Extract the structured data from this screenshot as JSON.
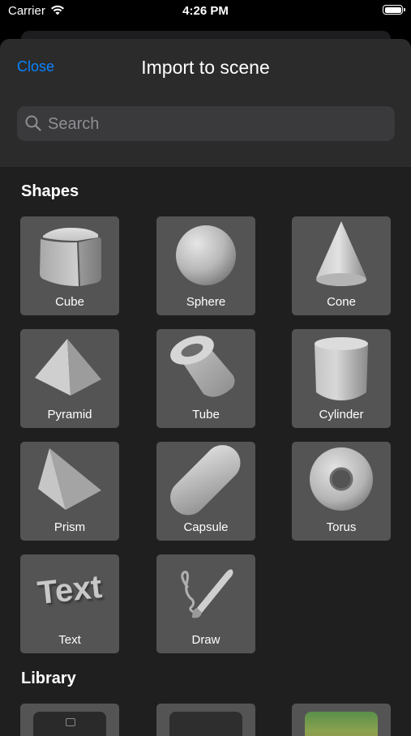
{
  "status_bar": {
    "carrier": "Carrier",
    "time": "4:26 PM"
  },
  "header": {
    "close_label": "Close",
    "title": "Import to scene",
    "search_placeholder": "Search"
  },
  "sections": {
    "shapes_title": "Shapes",
    "library_title": "Library"
  },
  "shapes": [
    {
      "label": "Cube",
      "icon": "cube-icon"
    },
    {
      "label": "Sphere",
      "icon": "sphere-icon"
    },
    {
      "label": "Cone",
      "icon": "cone-icon"
    },
    {
      "label": "Pyramid",
      "icon": "pyramid-icon"
    },
    {
      "label": "Tube",
      "icon": "tube-icon"
    },
    {
      "label": "Cylinder",
      "icon": "cylinder-icon"
    },
    {
      "label": "Prism",
      "icon": "prism-icon"
    },
    {
      "label": "Capsule",
      "icon": "capsule-icon"
    },
    {
      "label": "Torus",
      "icon": "torus-icon"
    },
    {
      "label": "Text",
      "icon": "text-shape-icon"
    },
    {
      "label": "Draw",
      "icon": "brush-icon"
    }
  ],
  "text_tile_art": "Text",
  "colors": {
    "accent": "#0a84ff",
    "tile": "#545454",
    "sheet": "#1f1f1f",
    "header": "#2b2b2b"
  }
}
